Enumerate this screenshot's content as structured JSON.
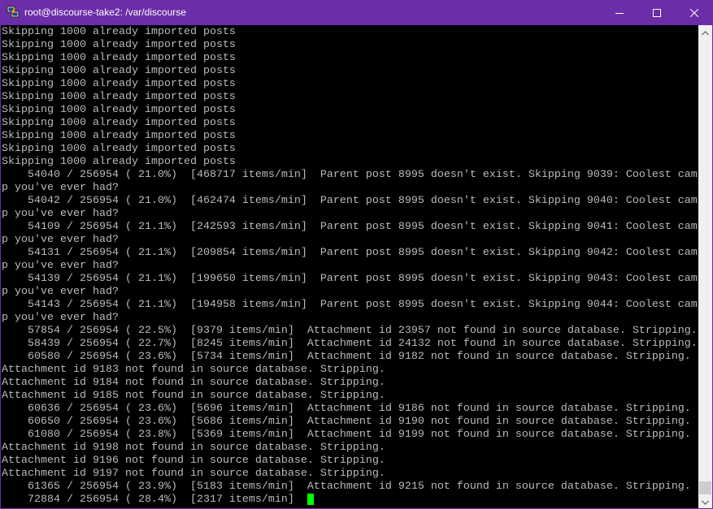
{
  "window": {
    "title": "root@discourse-take2: /var/discourse",
    "icon": "putty-icon",
    "controls": {
      "minimize": "minimize-icon",
      "maximize": "maximize-icon",
      "close": "close-icon"
    }
  },
  "colors": {
    "titlebar": "#6b2da8",
    "title_text": "#ffffff",
    "terminal_bg": "#000000",
    "terminal_fg": "#bbbbbb",
    "cursor": "#00ff00",
    "scrollbar_track": "#f0f0f0",
    "scrollbar_thumb": "#cdcdcd"
  },
  "terminal": {
    "lines": [
      "Skipping 1000 already imported posts",
      "Skipping 1000 already imported posts",
      "Skipping 1000 already imported posts",
      "Skipping 1000 already imported posts",
      "Skipping 1000 already imported posts",
      "Skipping 1000 already imported posts",
      "Skipping 1000 already imported posts",
      "Skipping 1000 already imported posts",
      "Skipping 1000 already imported posts",
      "Skipping 1000 already imported posts",
      "Skipping 1000 already imported posts",
      "    54040 / 256954 ( 21.0%)  [468717 items/min]  Parent post 8995 doesn't exist. Skipping 9039: Coolest cam",
      "p you've ever had?",
      "    54042 / 256954 ( 21.0%)  [462474 items/min]  Parent post 8995 doesn't exist. Skipping 9040: Coolest cam",
      "p you've ever had?",
      "    54109 / 256954 ( 21.1%)  [242593 items/min]  Parent post 8995 doesn't exist. Skipping 9041: Coolest cam",
      "p you've ever had?",
      "    54131 / 256954 ( 21.1%)  [209854 items/min]  Parent post 8995 doesn't exist. Skipping 9042: Coolest cam",
      "p you've ever had?",
      "    54139 / 256954 ( 21.1%)  [199650 items/min]  Parent post 8995 doesn't exist. Skipping 9043: Coolest cam",
      "p you've ever had?",
      "    54143 / 256954 ( 21.1%)  [194958 items/min]  Parent post 8995 doesn't exist. Skipping 9044: Coolest cam",
      "p you've ever had?",
      "    57854 / 256954 ( 22.5%)  [9379 items/min]  Attachment id 23957 not found in source database. Stripping.",
      "    58439 / 256954 ( 22.7%)  [8245 items/min]  Attachment id 24132 not found in source database. Stripping.",
      "    60580 / 256954 ( 23.6%)  [5734 items/min]  Attachment id 9182 not found in source database. Stripping.",
      "Attachment id 9183 not found in source database. Stripping.",
      "Attachment id 9184 not found in source database. Stripping.",
      "Attachment id 9185 not found in source database. Stripping.",
      "    60636 / 256954 ( 23.6%)  [5696 items/min]  Attachment id 9186 not found in source database. Stripping.",
      "    60650 / 256954 ( 23.6%)  [5686 items/min]  Attachment id 9190 not found in source database. Stripping.",
      "    61080 / 256954 ( 23.8%)  [5369 items/min]  Attachment id 9199 not found in source database. Stripping.",
      "Attachment id 9198 not found in source database. Stripping.",
      "Attachment id 9196 not found in source database. Stripping.",
      "Attachment id 9197 not found in source database. Stripping.",
      "    61365 / 256954 ( 23.9%)  [5183 items/min]  Attachment id 9215 not found in source database. Stripping.",
      "    72884 / 256954 ( 28.4%)  [2317 items/min]  "
    ]
  },
  "scrollbar": {
    "position": 1.0
  }
}
